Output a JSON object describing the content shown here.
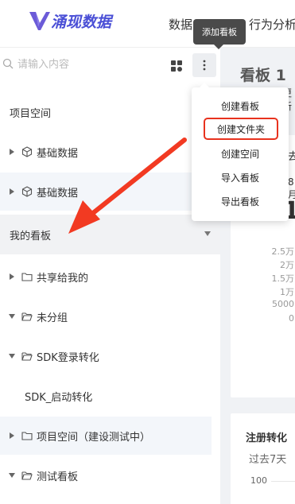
{
  "header": {
    "logo_text": "涌现数据",
    "nav": [
      "数据",
      "行为分析"
    ],
    "tooltip": "添加看板"
  },
  "search": {
    "placeholder": "请输入内容"
  },
  "sidebar": {
    "project_space_label": "项目空间",
    "project_items": [
      {
        "label": "基础数据"
      },
      {
        "label": "基础数据"
      }
    ],
    "my_boards_label": "我的看板",
    "folders": [
      {
        "label": "共享给我的",
        "expanded": false
      },
      {
        "label": "未分组",
        "expanded": true
      },
      {
        "label": "SDK登录转化",
        "expanded": true
      },
      {
        "label": "SDK_启动转化",
        "expanded": false
      },
      {
        "label": "项目空间（建设测试中）",
        "expanded": false
      },
      {
        "label": "测试看板",
        "expanded": true
      }
    ]
  },
  "menu": {
    "items": [
      "创建看板",
      "创建文件夹",
      "创建空间",
      "导入看板",
      "导出看板"
    ],
    "highlighted_index": 1,
    "highlight_color": "#e8321e"
  },
  "content": {
    "board_title": "看板 1",
    "update_text": "更新",
    "card1": {
      "date_text": "去",
      "range_text": "8月",
      "big_number": "1",
      "y_ticks": [
        "2.5万",
        "2万",
        "1.5万",
        "1万",
        "5000",
        "0"
      ]
    },
    "card2": {
      "title": "注册转化",
      "subtitle": "过去7天",
      "y_tick": "100"
    }
  },
  "colors": {
    "brand": "#4a4fd6",
    "arrow": "#f23a22",
    "section_bg": "#f1f2f4",
    "highlight_row_bg": "#f3f6fa"
  }
}
